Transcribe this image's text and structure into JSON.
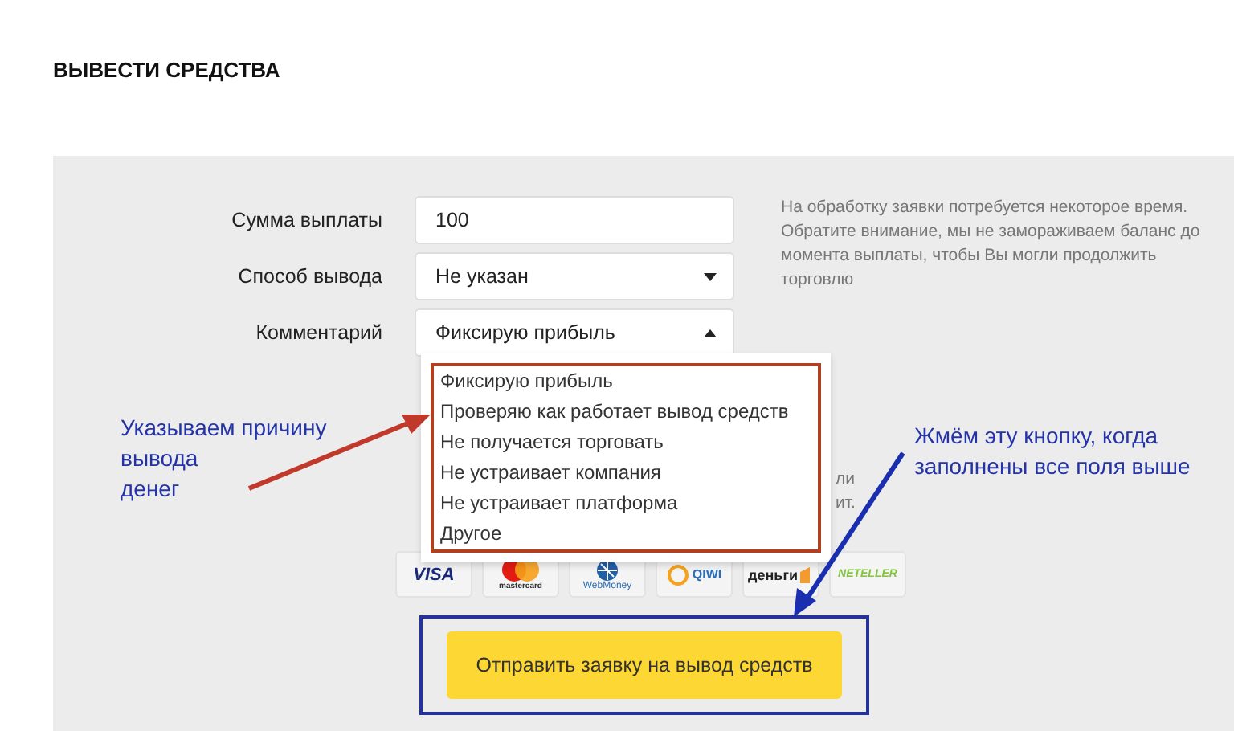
{
  "title": "ВЫВЕСТИ СРЕДСТВА",
  "fields": [
    {
      "label": "Сумма выплаты",
      "kind": "input",
      "value": "100"
    },
    {
      "label": "Способ вывода",
      "kind": "select",
      "value": "Не указан",
      "expanded": false
    },
    {
      "label": "Комментарий",
      "kind": "select",
      "value": "Фиксирую прибыль",
      "expanded": true
    }
  ],
  "note": "На обработку заявки потребуется некоторое время. Обратите внимание, мы не замораживаем баланс до момента выплаты, чтобы Вы могли продолжить торговлю",
  "hidden_note_lines": [
    "ли",
    "ит."
  ],
  "dropdown_options": [
    "Фиксирую прибыль",
    "Проверяю как работает вывод средств",
    "Не получается торговать",
    "Не устраивает компания",
    "Не устраивает платформа",
    "Другое"
  ],
  "payment_logos": [
    {
      "kind": "visa",
      "label": "VISA"
    },
    {
      "kind": "mastercard",
      "label": "mastercard"
    },
    {
      "kind": "webmoney",
      "label": "WebMoney"
    },
    {
      "kind": "qiwi",
      "label": "QIWI"
    },
    {
      "kind": "yandex",
      "label": "деньги"
    },
    {
      "kind": "neteller",
      "label": "NETELLER"
    }
  ],
  "submit_button": "Отправить заявку на вывод средств",
  "annotations": [
    {
      "kind": "left",
      "lines": [
        "Указываем причину",
        "вывода",
        "денег"
      ],
      "color": "#2433a8"
    },
    {
      "kind": "right",
      "lines": [
        "Жмём эту кнопку, когда",
        "заполнены все поля выше"
      ],
      "color": "#2433a8"
    }
  ]
}
